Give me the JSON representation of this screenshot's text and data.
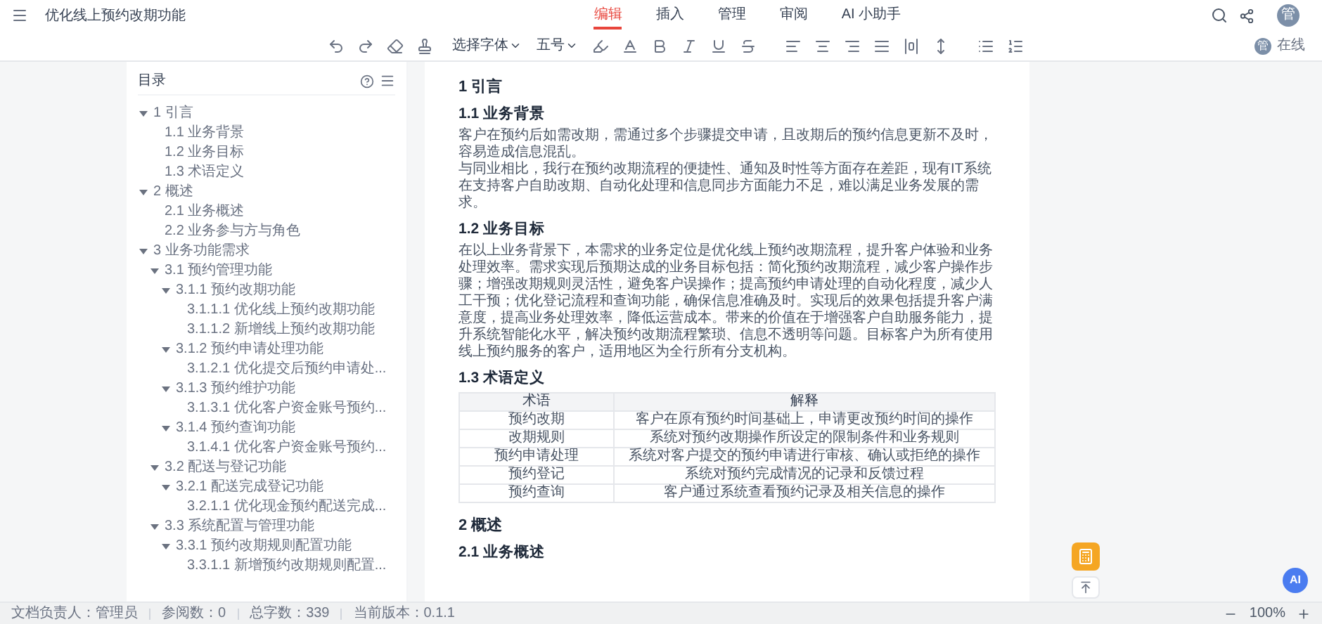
{
  "app": {
    "title": "优化线上预约改期功能",
    "avatar": "管"
  },
  "tabs": [
    {
      "label": "编辑",
      "selected": true
    },
    {
      "label": "插入",
      "selected": false
    },
    {
      "label": "管理",
      "selected": false
    },
    {
      "label": "审阅",
      "selected": false
    },
    {
      "label": "AI 小助手",
      "selected": false
    }
  ],
  "toolbar": {
    "font_family": "选择字体",
    "font_size": "五号"
  },
  "presence": {
    "avatar": "管",
    "status": "在线"
  },
  "toc": {
    "title": "目录",
    "items": [
      {
        "label": "1 引言",
        "expanded": true,
        "children": [
          {
            "label": "1.1 业务背景"
          },
          {
            "label": "1.2 业务目标"
          },
          {
            "label": "1.3 术语定义"
          }
        ]
      },
      {
        "label": "2 概述",
        "expanded": true,
        "children": [
          {
            "label": "2.1 业务概述"
          },
          {
            "label": "2.2 业务参与方与角色"
          }
        ]
      },
      {
        "label": "3 业务功能需求",
        "expanded": true,
        "children": [
          {
            "label": "3.1 预约管理功能",
            "expanded": true,
            "children": [
              {
                "label": "3.1.1 预约改期功能",
                "expanded": true,
                "children": [
                  {
                    "label": "3.1.1.1 优化线上预约改期功能"
                  },
                  {
                    "label": "3.1.1.2 新增线上预约改期功能"
                  }
                ]
              },
              {
                "label": "3.1.2 预约申请处理功能",
                "expanded": true,
                "children": [
                  {
                    "label": "3.1.2.1 优化提交后预约申请处..."
                  }
                ]
              },
              {
                "label": "3.1.3 预约维护功能",
                "expanded": true,
                "children": [
                  {
                    "label": "3.1.3.1 优化客户资金账号预约..."
                  }
                ]
              },
              {
                "label": "3.1.4 预约查询功能",
                "expanded": true,
                "children": [
                  {
                    "label": "3.1.4.1 优化客户资金账号预约..."
                  }
                ]
              }
            ]
          },
          {
            "label": "3.2 配送与登记功能",
            "expanded": true,
            "children": [
              {
                "label": "3.2.1 配送完成登记功能",
                "expanded": true,
                "children": [
                  {
                    "label": "3.2.1.1 优化现金预约配送完成..."
                  }
                ]
              }
            ]
          },
          {
            "label": "3.3 系统配置与管理功能",
            "expanded": true,
            "children": [
              {
                "label": "3.3.1 预约改期规则配置功能",
                "expanded": true,
                "children": [
                  {
                    "label": "3.3.1.1 新增预约改期规则配置..."
                  }
                ]
              }
            ]
          }
        ]
      }
    ]
  },
  "document": {
    "blocks": [
      {
        "kind": "h1",
        "text": "1 引言"
      },
      {
        "kind": "h2",
        "text": "1.1 业务背景"
      },
      {
        "kind": "p",
        "text": "客户在预约后如需改期，需通过多个步骤提交申请，且改期后的预约信息更新不及时，容易造成信息混乱。"
      },
      {
        "kind": "p",
        "text": "与同业相比，我行在预约改期流程的便捷性、通知及时性等方面存在差距，现有IT系统在支持客户自助改期、自动化处理和信息同步方面能力不足，难以满足业务发展的需求。"
      },
      {
        "kind": "h2",
        "text": "1.2 业务目标"
      },
      {
        "kind": "p",
        "text": "在以上业务背景下，本需求的业务定位是优化线上预约改期流程，提升客户体验和业务处理效率。需求实现后预期达成的业务目标包括：简化预约改期流程，减少客户操作步骤；增强改期规则灵活性，避免客户误操作；提高预约申请处理的自动化程度，减少人工干预；优化登记流程和查询功能，确保信息准确及时。实现后的效果包括提升客户满意度，提高业务处理效率，降低运营成本。带来的价值在于增强客户自助服务能力，提升系统智能化水平，解决预约改期流程繁琐、信息不透明等问题。目标客户为所有使用线上预约服务的客户，适用地区为全行所有分支机构。"
      },
      {
        "kind": "h2",
        "text": "1.3 术语定义"
      },
      {
        "kind": "table",
        "columns": [
          "术语",
          "解释"
        ],
        "rows": [
          [
            "预约改期",
            "客户在原有预约时间基础上，申请更改预约时间的操作"
          ],
          [
            "改期规则",
            "系统对预约改期操作所设定的限制条件和业务规则"
          ],
          [
            "预约申请处理",
            "系统对客户提交的预约申请进行审核、确认或拒绝的操作"
          ],
          [
            "预约登记",
            "系统对预约完成情况的记录和反馈过程"
          ],
          [
            "预约查询",
            "客户通过系统查看预约记录及相关信息的操作"
          ]
        ]
      },
      {
        "kind": "h1",
        "text": "2 概述"
      },
      {
        "kind": "h2",
        "text": "2.1 业务概述"
      }
    ]
  },
  "floating": {
    "ai_label": "AI"
  },
  "status_bar": {
    "items": [
      "文档负责人：管理员",
      "参阅数：0",
      "总字数：339",
      "当前版本：0.1.1"
    ],
    "zoom": "100%"
  }
}
